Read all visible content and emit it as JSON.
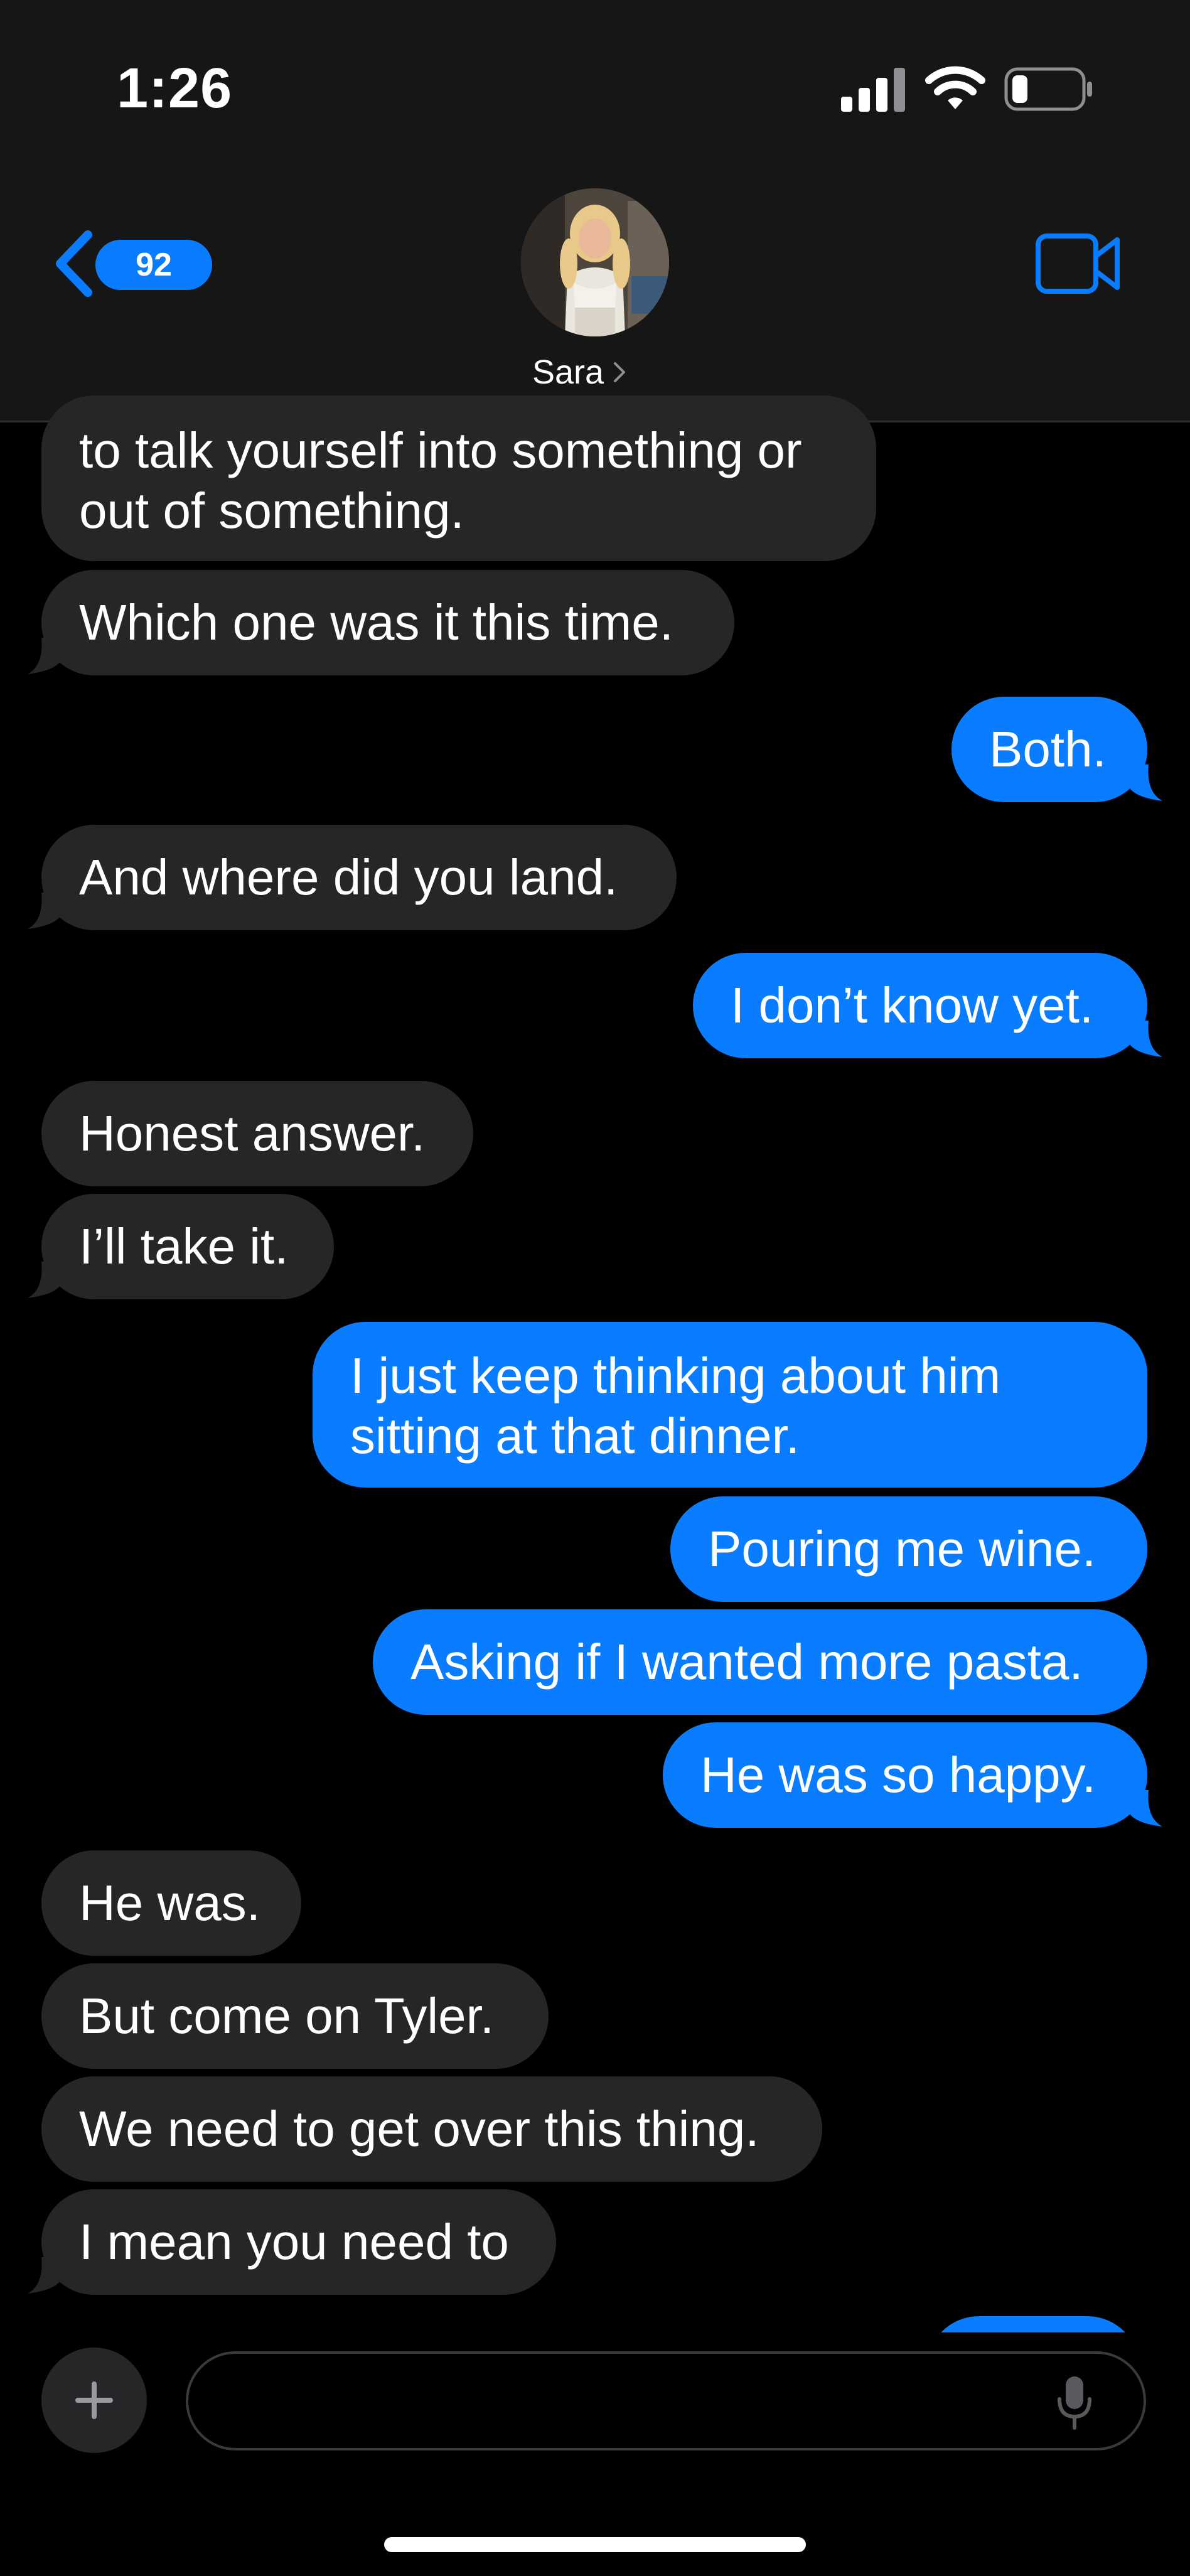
{
  "status_bar": {
    "time": "1:26"
  },
  "header": {
    "unread_count": "92",
    "contact_name": "Sara"
  },
  "messages": [
    {
      "from": "them",
      "lines": [
        "to talk yourself into something or",
        "out of something."
      ]
    },
    {
      "from": "them",
      "text": "Which one was it this time."
    },
    {
      "from": "me",
      "text": "Both."
    },
    {
      "from": "them",
      "text": "And where did you land."
    },
    {
      "from": "me",
      "text": "I don’t know yet."
    },
    {
      "from": "them",
      "text": "Honest answer."
    },
    {
      "from": "them",
      "text": "I’ll take it."
    },
    {
      "from": "me",
      "lines": [
        "I just keep thinking about him",
        "sitting at that dinner."
      ]
    },
    {
      "from": "me",
      "text": "Pouring me wine."
    },
    {
      "from": "me",
      "text": "Asking if I wanted more pasta."
    },
    {
      "from": "me",
      "text": "He was so happy."
    },
    {
      "from": "them",
      "text": "He was."
    },
    {
      "from": "them",
      "text": "But come on Tyler."
    },
    {
      "from": "them",
      "text": "We need to get over this thing."
    },
    {
      "from": "them",
      "text": "I mean you need to"
    }
  ],
  "composer": {
    "placeholder": ""
  },
  "colors": {
    "outgoing_bubble": "#0a7cff",
    "incoming_bubble": "#262628",
    "header_bg": "#161616",
    "background": "#000000"
  },
  "icons": {
    "back": "chevron-left-icon",
    "video": "video-camera-icon",
    "plus": "plus-icon",
    "mic": "microphone-icon"
  }
}
